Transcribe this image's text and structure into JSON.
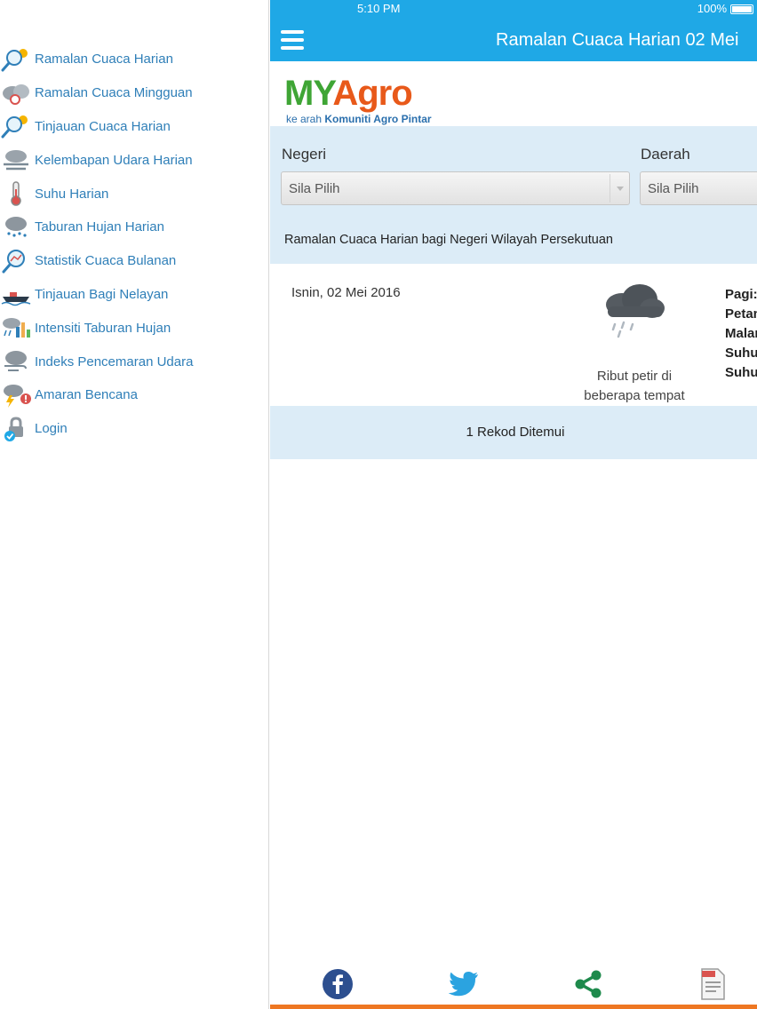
{
  "status_bar": {
    "time": "5:10 PM",
    "battery": "100%"
  },
  "header": {
    "title": "Ramalan Cuaca Harian 02 Mei"
  },
  "logo": {
    "my": "MY",
    "agro": "Agro",
    "tagline_prefix": "ke arah ",
    "tagline_bold": "Komuniti Agro Pintar"
  },
  "sidebar": {
    "items": [
      {
        "label": "Ramalan Cuaca Harian",
        "icon": "magnifier-sun-icon"
      },
      {
        "label": "Ramalan Cuaca Mingguan",
        "icon": "cloud-calendar-icon"
      },
      {
        "label": "Tinjauan Cuaca Harian",
        "icon": "magnifier-sun-icon"
      },
      {
        "label": "Kelembapan Udara Harian",
        "icon": "cloud-fog-icon"
      },
      {
        "label": "Suhu Harian",
        "icon": "thermometer-icon"
      },
      {
        "label": "Taburan Hujan Harian",
        "icon": "cloud-rain-icon"
      },
      {
        "label": "Statistik Cuaca Bulanan",
        "icon": "magnifier-chart-icon"
      },
      {
        "label": "Tinjauan Bagi Nelayan",
        "icon": "boat-icon"
      },
      {
        "label": "Intensiti Taburan Hujan",
        "icon": "rain-chart-icon"
      },
      {
        "label": "Indeks Pencemaran Udara",
        "icon": "cloud-wind-icon"
      },
      {
        "label": "Amaran Bencana",
        "icon": "storm-warning-icon"
      },
      {
        "label": "Login",
        "icon": "lock-check-icon"
      }
    ]
  },
  "filters": {
    "negeri_label": "Negeri",
    "negeri_value": "Sila Pilih",
    "daerah_label": "Daerah",
    "daerah_value": "Sila Pilih"
  },
  "region_title": "Ramalan Cuaca Harian bagi Negeri Wilayah Persekutuan",
  "forecast": {
    "date": "Isnin, 02 Mei 2016",
    "icon": "cloud-rain-icon",
    "desc_line1": "Ribut petir di",
    "desc_line2": "beberapa tempat",
    "labels": [
      "Pagi:",
      "Petang",
      "Malam",
      "Suhu",
      "Suhu"
    ]
  },
  "records": "1 Rekod Ditemui",
  "footer": {
    "buttons": [
      "facebook-icon",
      "twitter-icon",
      "share-icon",
      "pdf-icon"
    ]
  },
  "colors": {
    "header_bg": "#1fa8e6",
    "filter_bg": "#dcecf7",
    "menu_text": "#2f7fb8",
    "footer_line": "#ee7722"
  }
}
